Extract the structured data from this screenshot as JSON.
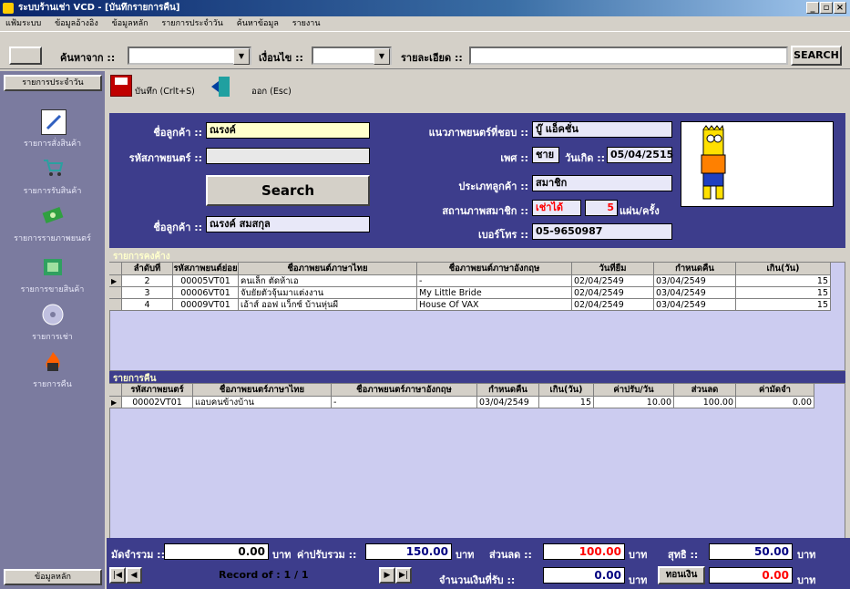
{
  "window": {
    "title": "ระบบร้านเช่า VCD - [บันทึกรายการคืน]"
  },
  "menu": [
    "แฟ้มระบบ",
    "ข้อมูลอ้างอิง",
    "ข้อมูลหลัก",
    "รายการประจำวัน",
    "ค้นหาข้อมูล",
    "รายงาน"
  ],
  "search": {
    "from_label": "ค้นหาจาก ::",
    "condition_label": "เงื่อนไข ::",
    "detail_label": "รายละเอียด ::",
    "button": "SEARCH"
  },
  "sidebar": {
    "header": "รายการประจำวัน",
    "items": [
      {
        "label": "รายการสั่งสินค้า",
        "icon": "pencil-icon"
      },
      {
        "label": "รายการรับสินค้า",
        "icon": "cart-icon"
      },
      {
        "label": "รายการรายภาพยนตร์",
        "icon": "money-icon"
      },
      {
        "label": "รายการขายสินค้า",
        "icon": "sell-icon"
      },
      {
        "label": "รายการเช่า",
        "icon": "cd-icon"
      },
      {
        "label": "รายการคืน",
        "icon": "fire-icon"
      }
    ],
    "footer": "ข้อมูลหลัก"
  },
  "toolbar": {
    "save_label": "บันทึก (Crlt+S)",
    "exit_label": "ออก (Esc)"
  },
  "customer": {
    "name_label": "ชื่อลูกค้า ::",
    "name_value": "ณรงค์",
    "movie_code_label": "รหัสภาพยนตร์ ::",
    "movie_code_value": "",
    "search_button": "Search",
    "fullname_label": "ชื่อลูกค้า ::",
    "fullname_value": "ณรงค์ สมสกุล",
    "genre_label": "แนวภาพยนตร์ที่ชอบ ::",
    "genre_value": "บู๊ แอ็คชั่น",
    "sex_label": "เพศ ::",
    "sex_value": "ชาย",
    "birth_label": "วันเกิด ::",
    "birth_value": "05/04/2515",
    "type_label": "ประเภทลูกค้า ::",
    "type_value": "สมาชิก",
    "status_label": "สถานภาพสมาชิก ::",
    "status_value": "เช่าได้",
    "limit_value": "5",
    "limit_unit": "แผ่น/ครั้ง",
    "phone_label": "เบอร์โทร ::",
    "phone_value": "05-9650987"
  },
  "outstanding": {
    "title": "รายการคงค้าง",
    "columns": [
      "ลำดับที่",
      "รหัสภาพยนต์ย่อย",
      "ชื่อภาพยนต์ภาษาไทย",
      "ชื่อภาพยนต์ภาษาอังกฤษ",
      "วันที่ยืม",
      "กำหนดคืน",
      "เกิน(วัน)"
    ],
    "rows": [
      [
        "2",
        "00005VT01",
        "คนเล็ก ตัดห้าเอ",
        "-",
        "02/04/2549",
        "03/04/2549",
        "15"
      ],
      [
        "3",
        "00006VT01",
        "จับยัยตัวจุ้นมาแต่งงาน",
        "My Little Bride",
        "02/04/2549",
        "03/04/2549",
        "15"
      ],
      [
        "4",
        "00009VT01",
        "เอ้าส์ ออฟ แว็กซ์ บ้านหุ่นผี",
        "House Of VAX",
        "02/04/2549",
        "03/04/2549",
        "15"
      ]
    ]
  },
  "returns": {
    "title": "รายการคืน",
    "columns": [
      "รหัสภาพยนตร์",
      "ชื่อภาพยนตร์ภาษาไทย",
      "ชื่อภาพยนตร์ภาษาอังกฤษ",
      "กำหนดคืน",
      "เกิน(วัน)",
      "ค่าปรับ/วัน",
      "ส่วนลด",
      "ค่ามัดจำ"
    ],
    "rows": [
      [
        "00002VT01",
        "แอบคนข้างบ้าน",
        "-",
        "03/04/2549",
        "15",
        "10.00",
        "100.00",
        "0.00"
      ]
    ]
  },
  "totals": {
    "deposit_label": "มัดจำรวม ::",
    "deposit_value": "0.00",
    "fine_label": "ค่าปรับรวม ::",
    "fine_value": "150.00",
    "discount_label": "ส่วนลด ::",
    "discount_value": "100.00",
    "net_label": "สุทธิ ::",
    "net_value": "50.00",
    "baht": "บาท",
    "received_label": "จำนวนเงินที่รับ ::",
    "received_value": "0.00",
    "change_button": "ทอนเงิน",
    "change_value": "0.00",
    "record_text": "Record of : 1 / 1"
  },
  "colors": {
    "panel": "#3d3d8c",
    "sidebar": "#7b7b9f",
    "grid_bg": "#ccccf0",
    "red": "#ff0000",
    "yellow_field": "#ffffcc"
  }
}
